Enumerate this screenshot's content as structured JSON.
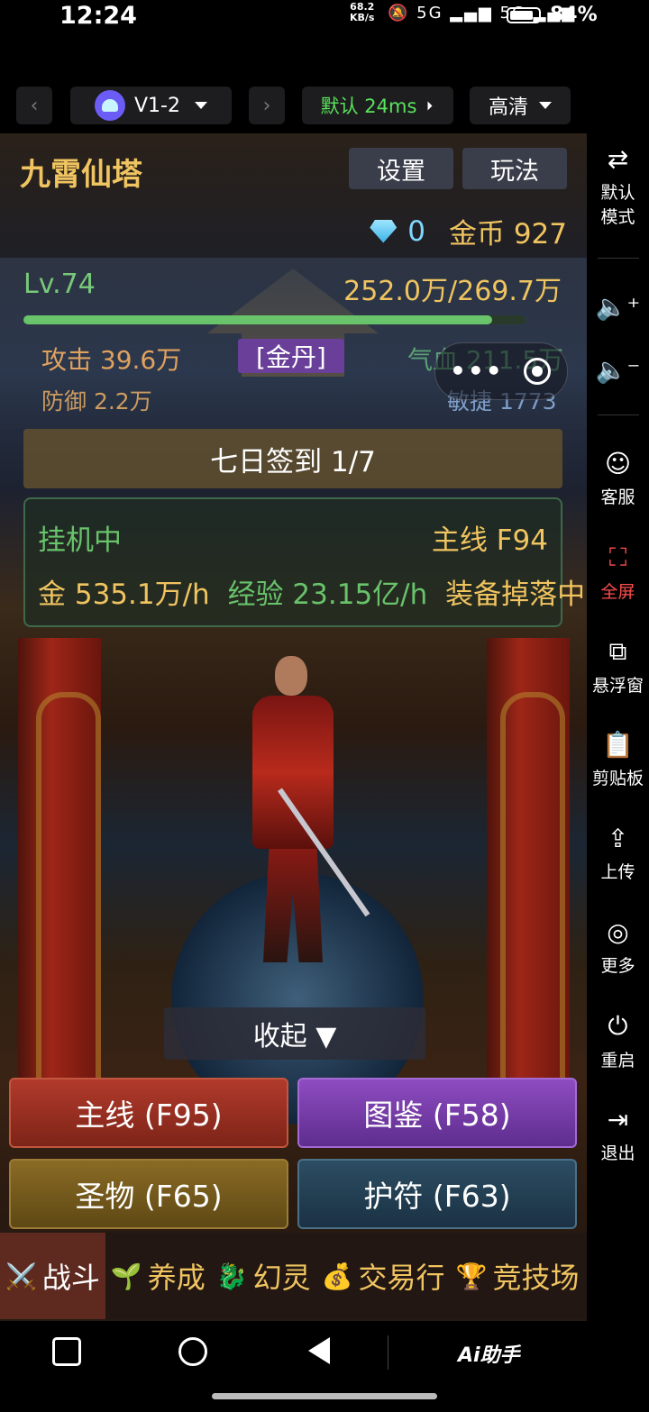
{
  "status_bar": {
    "time": "12:24",
    "net_speed_value": "68.2",
    "net_speed_unit": "KB/s",
    "signal_icons": "🔕 5G ▂▄▆ 5G ▂▄▆",
    "battery_percent": "84%",
    "battery_level": 0.84
  },
  "toolbar": {
    "prev_icon": "‹",
    "next_icon": "›",
    "device_name": "V1-2",
    "line_label": "默认 24ms",
    "quality_label": "高清"
  },
  "game": {
    "title": "九霄仙塔",
    "settings_label": "设置",
    "guide_label": "玩法",
    "diamonds": "0",
    "gold_label": "金币 927",
    "level": "Lv.74",
    "exp_text": "252.0万/269.7万",
    "exp_fraction": 0.934,
    "attack": "攻击 39.6万",
    "defense": "防御 2.2万",
    "realm": "[金丹]",
    "hp": "气血 211.5万",
    "agility": "敏捷 1773",
    "signin": "七日签到 1/7",
    "afk": {
      "status": "挂机中",
      "stage": "主线 F94",
      "gold_rate": "金 535.1万/h",
      "exp_rate": "经验 23.15亿/h",
      "drop_status": "装备掉落中"
    },
    "collapse_label": "收起 ▼",
    "features": {
      "main": "主线 (F95)",
      "codex": "图鉴 (F58)",
      "relic": "圣物 (F65)",
      "amulet": "护符 (F63)"
    },
    "tabs": [
      {
        "icon": "⚔️",
        "label": "战斗"
      },
      {
        "icon": "🌱",
        "label": "养成"
      },
      {
        "icon": "🐉",
        "label": "幻灵"
      },
      {
        "icon": "💰",
        "label": "交易行"
      },
      {
        "icon": "🏆",
        "label": "竞技场"
      }
    ]
  },
  "side_panel": {
    "mode": "默认\n模式",
    "service": "客服",
    "fullscreen": "全屏",
    "float_window": "悬浮窗",
    "clipboard": "剪贴板",
    "upload": "上传",
    "more": "更多",
    "restart": "重启",
    "exit": "退出"
  },
  "nav_bar": {
    "assistant": "Ai助手"
  }
}
